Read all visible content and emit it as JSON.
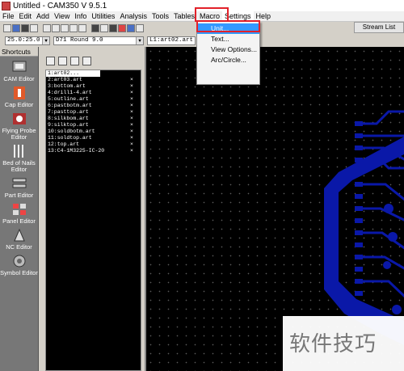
{
  "window": {
    "title": "Untitled - CAM350 V 9.5.1"
  },
  "menu": {
    "items": [
      "File",
      "Edit",
      "Add",
      "View",
      "Info",
      "Utilities",
      "Analysis",
      "Tools",
      "Tables",
      "Macro",
      "Settings",
      "Help"
    ],
    "active": "Settings"
  },
  "settings_menu": {
    "items": [
      "Unit...",
      "Text...",
      "View Options...",
      "Arc/Circle..."
    ],
    "selected_index": 0
  },
  "stream_list_label": "Stream List",
  "toolbar2": {
    "coord_combo": "25.0:25.0",
    "dcode_combo": "D71   Round 9.0",
    "layer_combo": "L1:art02.art"
  },
  "shortcuts": {
    "header": "Shortcuts",
    "items": [
      {
        "label": "CAM Editor",
        "icon": "cam-editor-icon"
      },
      {
        "label": "Cap Editor",
        "icon": "cap-editor-icon"
      },
      {
        "label": "Flying Probe Editor",
        "icon": "flying-probe-icon"
      },
      {
        "label": "Bed of Nails Editor",
        "icon": "bed-of-nails-icon"
      },
      {
        "label": "Part Editor",
        "icon": "part-editor-icon"
      },
      {
        "label": "Panel Editor",
        "icon": "panel-editor-icon"
      },
      {
        "label": "NC Editor",
        "icon": "nc-editor-icon"
      },
      {
        "label": "Symbol Editor",
        "icon": "symbol-editor-icon"
      }
    ]
  },
  "layers": [
    "1:art02...",
    "2:art03.art",
    "3:bottom.art",
    "4:drill1-4.art",
    "5:outline.art",
    "6:pastbotm.art",
    "7:pasttop.art",
    "8:silkbom.art",
    "9:silktop.art",
    "10:soldbotm.art",
    "11:soldtop.art",
    "12:top.art",
    "13:C4-1M3225-IC-20"
  ],
  "layer_close_glyph": "×",
  "selected_layer_index": 0,
  "watermark": "软件技巧",
  "colors": {
    "highlight_red": "#e2212a",
    "menu_selected": "#3399ff",
    "copper": "#0a18a8",
    "canvas": "#000000"
  }
}
